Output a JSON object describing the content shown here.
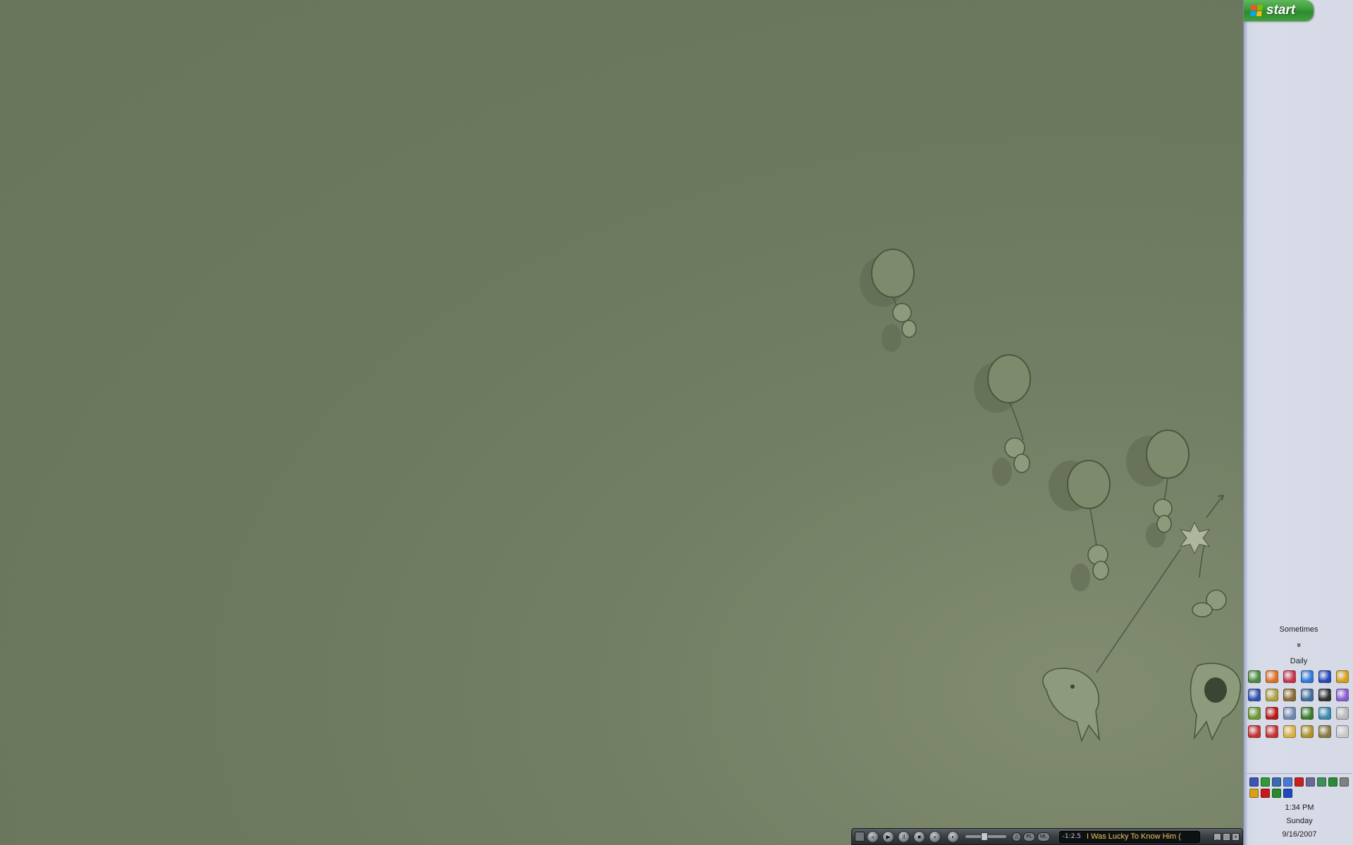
{
  "taskbar": {
    "start_label": "start",
    "toolbar_sometimes": "Sometimes",
    "toolbar_daily": "Daily",
    "chevron": "»",
    "quick_launch_icons": [
      "mail-icon",
      "firefox-icon",
      "itunes-icon",
      "internet-explorer-icon",
      "messenger-icon",
      "winamp-icon",
      "window-icon",
      "tools-icon",
      "folder-tree-icon",
      "calculator-icon",
      "flower-app-icon",
      "globe-icon",
      "app-group-icon",
      "media-app-icon",
      "cloud-app-icon",
      "checkmark-icon",
      "disk-app-icon",
      "notepad-icon",
      "vc-app-icon",
      "vc-app-icon-2",
      "folder-icon",
      "document-icon",
      "notes-icon",
      "blank-app-icon"
    ],
    "tray_icons": [
      "network-icon",
      "green-app-icon",
      "display-icon",
      "volume-icon",
      "disconnected-icon",
      "shield-icon",
      "update-icon",
      "antivirus-icon",
      "printer-icon",
      "pencil-icon",
      "k-app-icon",
      "signal-icon",
      "bluetooth-icon"
    ],
    "clock": {
      "time": "1:34 PM",
      "day": "Sunday",
      "date": "9/16/2007"
    }
  },
  "media_player": {
    "time": "-1:2.5",
    "track_title": "I Was Lucky To Know Him (",
    "volume_level": 0.45,
    "buttons": {
      "prev": "«",
      "play": "▶",
      "pause": "II",
      "stop": "■",
      "next": "»",
      "shade": "△",
      "playlist": "PL",
      "library": "ML"
    },
    "window_controls": {
      "minimize": "_",
      "maximize": "□",
      "close": "×"
    }
  },
  "colors": {
    "desktop_bg": "#6e7a5f",
    "taskbar_bg": "#d6dae6",
    "start_green": "#3c9a3a",
    "track_title": "#e7c75a"
  }
}
